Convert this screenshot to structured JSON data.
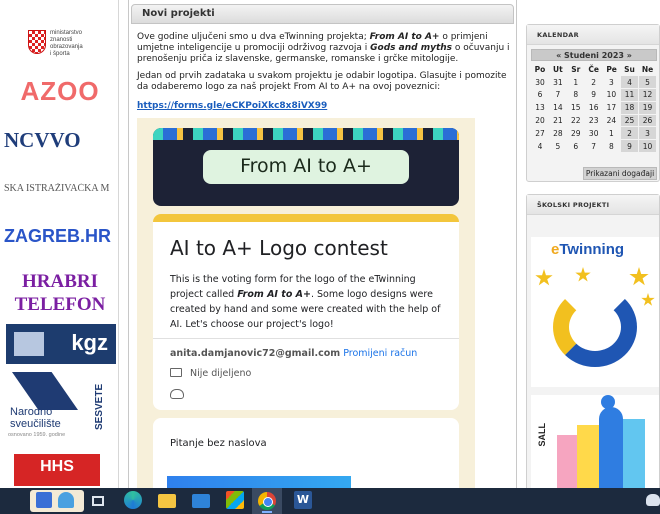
{
  "left_logos": {
    "mzo": "ministarstvo\nznanosti\nobrazovanja\ni športa",
    "azoo": "AZOO",
    "ncvvo": "NCVVO",
    "ska": "SKA ISTRAŽIVAČKA M",
    "zagreb": "ZAGREB.HR",
    "hrabri": "HRABRI\nTELEFON",
    "kgz": "kgz",
    "nsv_vertical": "SESVETE",
    "nsv_name": "Narodno\nsveučilište",
    "nsv_founded": "osnovano 1959. godine",
    "hhs": "HHS"
  },
  "center": {
    "header": "Novi projekti",
    "p1_pre": "Ove godine uljučeni smo u dva eTwinning projekta; ",
    "p1_b1": "From AI to A+",
    "p1_mid": " o primjeni umjetne inteligencije u promociji održivog razvoja i ",
    "p1_b2": "Gods and myths",
    "p1_post": " o očuvanju i prenošenju priča iz slavenske, germanske, romanske i grčke mitologije.",
    "p2": "Jedan od prvih zadataka u svakom projektu je odabir logotipa. Glasujte i pomozite da odaberemo logo za naš projekt From AI to A+ na ovoj poveznici:",
    "link": "https://forms.gle/eCKPoiXkc8x8iVX99"
  },
  "form": {
    "banner_text": "From AI to A+",
    "title": "AI to A+ Logo contest",
    "desc_pre": "This is the voting form for the logo of the eTwinning project called ",
    "desc_b": "From AI to A+",
    "desc_post": ". Some logo designs were created by hand and some were created with  the help of AI. Let's choose our project's logo!",
    "email": "anita.damjanovic72@gmail.com",
    "switch": "Promijeni račun",
    "shared": "Nije dijeljeno",
    "question": "Pitanje bez naslova"
  },
  "calendar": {
    "header": "KALENDAR",
    "month": "« Studeni 2023 »",
    "days": [
      "Po",
      "Ut",
      "Sr",
      "Če",
      "Pe",
      "Su",
      "Ne"
    ],
    "weeks": [
      [
        "30",
        "31",
        "1",
        "2",
        "3",
        "4",
        "5"
      ],
      [
        "6",
        "7",
        "8",
        "9",
        "10",
        "11",
        "12"
      ],
      [
        "13",
        "14",
        "15",
        "16",
        "17",
        "18",
        "19"
      ],
      [
        "20",
        "21",
        "22",
        "23",
        "24",
        "25",
        "26"
      ],
      [
        "27",
        "28",
        "29",
        "30",
        "1",
        "2",
        "3"
      ],
      [
        "4",
        "5",
        "6",
        "7",
        "8",
        "9",
        "10"
      ]
    ],
    "events_button": "Prikazani događaji"
  },
  "projects": {
    "header": "ŠKOLSKI PROJEKTI",
    "twinning": "Twinning",
    "sall": "SALL"
  },
  "colors": {
    "link": "#1a5dbd",
    "form_accent": "#f3c63c",
    "calendar_weekend": "#d6d6d6",
    "taskbar": "#1c2a3e"
  }
}
